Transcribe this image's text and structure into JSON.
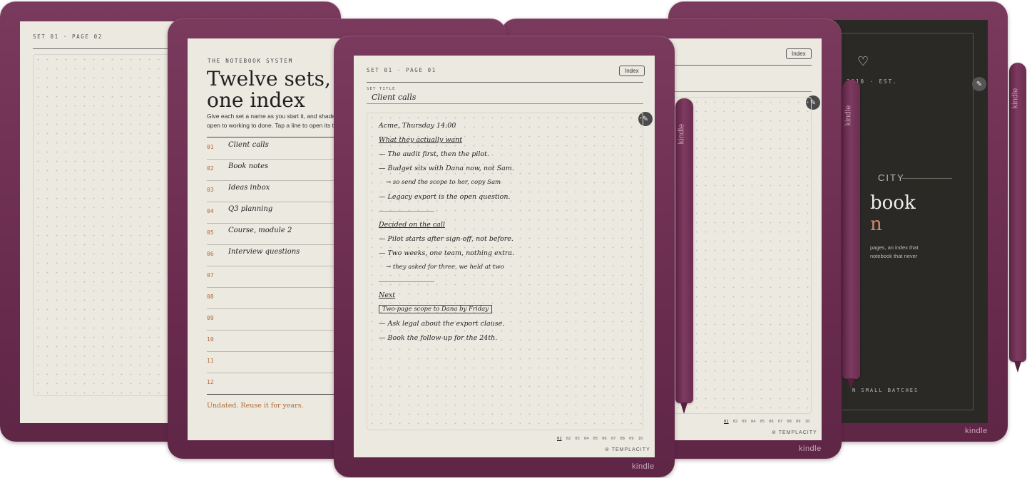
{
  "devices": {
    "back_left": {
      "page_label": "SET 01 · PAGE 02"
    },
    "index_device": {
      "kicker": "THE NOTEBOOK SYSTEM",
      "title_line1": "Twelve sets,",
      "title_line2": "one index",
      "desc_line1": "Give each set a name as you start it, and shade",
      "desc_line2": "open to working to done. Tap a line to open its t",
      "rows": [
        {
          "num": "01",
          "name": "Client calls"
        },
        {
          "num": "02",
          "name": "Book notes"
        },
        {
          "num": "03",
          "name": "Ideas inbox"
        },
        {
          "num": "04",
          "name": "Q3 planning"
        },
        {
          "num": "05",
          "name": "Course, module 2"
        },
        {
          "num": "06",
          "name": "Interview questions"
        },
        {
          "num": "07",
          "name": ""
        },
        {
          "num": "08",
          "name": ""
        },
        {
          "num": "09",
          "name": ""
        },
        {
          "num": "10",
          "name": ""
        },
        {
          "num": "11",
          "name": ""
        },
        {
          "num": "12",
          "name": ""
        }
      ],
      "footer": "Undated. Reuse it for years."
    },
    "center": {
      "page_label": "SET 01 · PAGE 01",
      "index_label": "Index",
      "set_title_label": "SET TITLE",
      "set_title": "Client calls",
      "notes": [
        {
          "text": "Acme, Thursday 14:00",
          "style": "plain"
        },
        {
          "text": "What they actually want",
          "style": "head"
        },
        {
          "text": "— The audit first, then the pilot.",
          "style": "plain"
        },
        {
          "text": "— Budget sits with Dana now, not Sam.",
          "style": "plain"
        },
        {
          "text": "→ so send the scope to her, copy Sam",
          "style": "indent"
        },
        {
          "text": "— Legacy export is the open question.",
          "style": "plain"
        },
        {
          "text": "Decided on the call",
          "style": "head"
        },
        {
          "text": "— Pilot starts after sign-off, not before.",
          "style": "plain"
        },
        {
          "text": "— Two weeks, one team, nothing extra.",
          "style": "plain"
        },
        {
          "text": "→ they asked for three, we held at two",
          "style": "indent"
        },
        {
          "text": "Next",
          "style": "head"
        },
        {
          "text": "Two-page scope to Dana by Friday",
          "style": "boxed"
        },
        {
          "text": "— Ask legal about the export clause.",
          "style": "plain"
        },
        {
          "text": "— Book the follow-up for the 24th.",
          "style": "plain"
        }
      ],
      "pager": [
        "01",
        "02",
        "03",
        "04",
        "05",
        "06",
        "07",
        "08",
        "09",
        "10"
      ],
      "templacity": "TEMPLACITY",
      "brand": "kindle"
    },
    "right_device": {
      "index_label": "Index",
      "pager": [
        "01",
        "02",
        "03",
        "04",
        "05",
        "06",
        "07",
        "08",
        "09",
        "10"
      ],
      "templacity": "TEMPLACITY",
      "brand": "kindle"
    },
    "dark_device": {
      "est": "2010 · EST.",
      "city": "CITY",
      "title_line1": "book",
      "title_line2": "n",
      "desc_line1": "pages, an index that",
      "desc_line2": "notebook that never",
      "footer": "N SMALL BATCHES",
      "brand": "kindle"
    }
  },
  "pens": {
    "brand": "kindle"
  },
  "colors": {
    "device": "#6a2c4f",
    "paper": "#ece9e1",
    "accent": "#b06a33",
    "dark_screen": "#2b2926"
  }
}
